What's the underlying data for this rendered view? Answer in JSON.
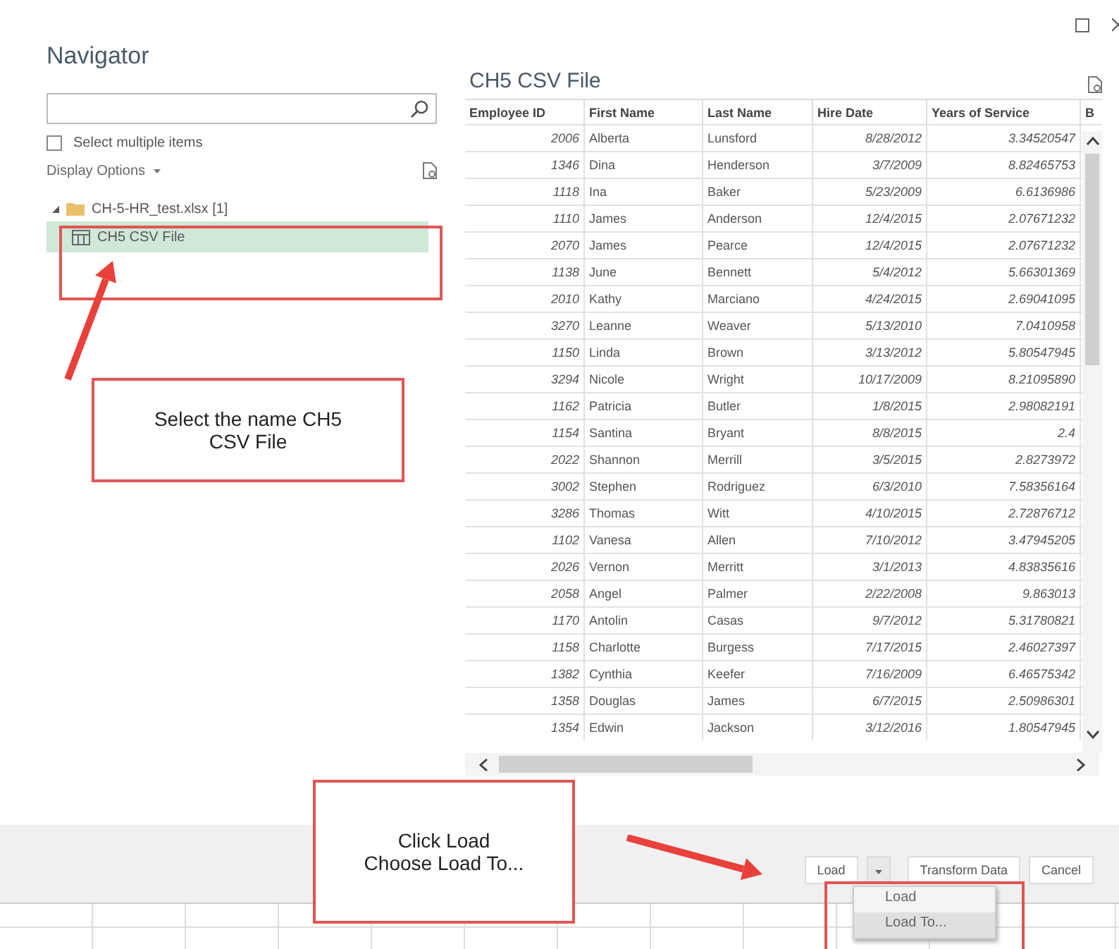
{
  "window": {
    "title": "Navigator"
  },
  "left_panel": {
    "select_multiple": {
      "label": "Select multiple items",
      "checked": false
    },
    "display_options": "Display Options",
    "tree": [
      {
        "label": "CH-5-HR_test.xlsx [1]",
        "expanded": true,
        "children": [
          {
            "label": "CH5 CSV File",
            "selected": true
          }
        ]
      }
    ]
  },
  "preview": {
    "title": "CH5 CSV File",
    "columns": [
      "Employee ID",
      "First Name",
      "Last Name",
      "Hire Date",
      "Years of Service",
      "B"
    ],
    "rows": [
      [
        "2006",
        "Alberta",
        "Lunsford",
        "8/28/2012",
        "3.34520547"
      ],
      [
        "1346",
        "Dina",
        "Henderson",
        "3/7/2009",
        "8.82465753"
      ],
      [
        "1118",
        "Ina",
        "Baker",
        "5/23/2009",
        "6.6136986"
      ],
      [
        "1110",
        "James",
        "Anderson",
        "12/4/2015",
        "2.07671232"
      ],
      [
        "2070",
        "James",
        "Pearce",
        "12/4/2015",
        "2.07671232"
      ],
      [
        "1138",
        "June",
        "Bennett",
        "5/4/2012",
        "5.66301369"
      ],
      [
        "2010",
        "Kathy",
        "Marciano",
        "4/24/2015",
        "2.69041095"
      ],
      [
        "3270",
        "Leanne",
        "Weaver",
        "5/13/2010",
        "7.0410958"
      ],
      [
        "1150",
        "Linda",
        "Brown",
        "3/13/2012",
        "5.80547945"
      ],
      [
        "3294",
        "Nicole",
        "Wright",
        "10/17/2009",
        "8.21095890"
      ],
      [
        "1162",
        "Patricia",
        "Butler",
        "1/8/2015",
        "2.98082191"
      ],
      [
        "1154",
        "Santina",
        "Bryant",
        "8/8/2015",
        "2.4"
      ],
      [
        "2022",
        "Shannon",
        "Merrill",
        "3/5/2015",
        "2.8273972"
      ],
      [
        "3002",
        "Stephen",
        "Rodriguez",
        "6/3/2010",
        "7.58356164"
      ],
      [
        "3286",
        "Thomas",
        "Witt",
        "4/10/2015",
        "2.72876712"
      ],
      [
        "1102",
        "Vanesa",
        "Allen",
        "7/10/2012",
        "3.47945205"
      ],
      [
        "2026",
        "Vernon",
        "Merritt",
        "3/1/2013",
        "4.83835616"
      ],
      [
        "2058",
        "Angel",
        "Palmer",
        "2/22/2008",
        "9.863013"
      ],
      [
        "1170",
        "Antolin",
        "Casas",
        "9/7/2012",
        "5.31780821"
      ],
      [
        "1158",
        "Charlotte",
        "Burgess",
        "7/17/2015",
        "2.46027397"
      ],
      [
        "1382",
        "Cynthia",
        "Keefer",
        "7/16/2009",
        "6.46575342"
      ],
      [
        "1358",
        "Douglas",
        "James",
        "6/7/2015",
        "2.50986301"
      ],
      [
        "1354",
        "Edwin",
        "Jackson",
        "3/12/2016",
        "1.80547945"
      ]
    ]
  },
  "buttons": [
    {
      "label": "Load",
      "kind": "split"
    },
    {
      "label": "Transform Data",
      "kind": "plain"
    },
    {
      "label": "Cancel",
      "kind": "plain"
    }
  ],
  "load_menu": [
    {
      "label": "Load",
      "selected": false
    },
    {
      "label": "Load To...",
      "selected": true
    }
  ],
  "annotations": {
    "callouts": [
      {
        "lines": [
          "Select the name CH5",
          "CSV File"
        ]
      },
      {
        "lines": [
          "Click Load",
          "Choose Load To..."
        ]
      }
    ]
  }
}
